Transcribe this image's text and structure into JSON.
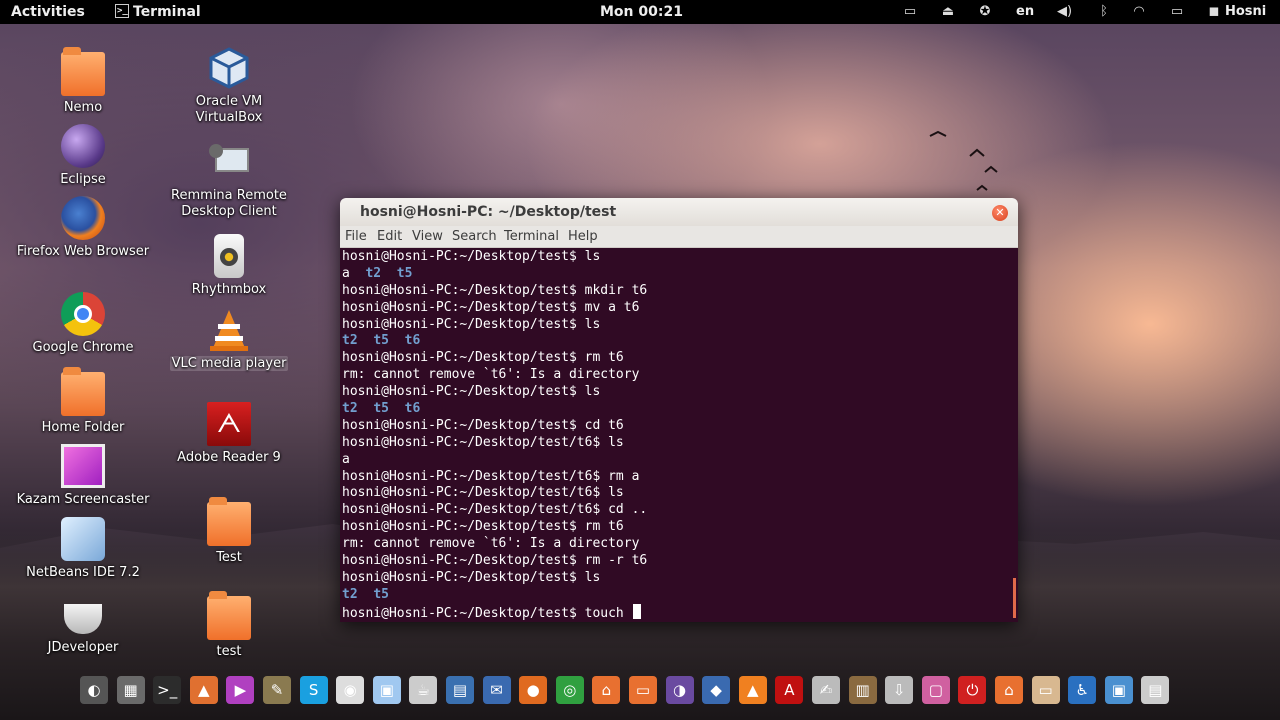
{
  "topbar": {
    "activities": "Activities",
    "app_menu": "Terminal",
    "clock": "Mon 00:21",
    "language": "en",
    "user": "Hosni",
    "tray_icons": [
      "folder-icon",
      "eject-icon",
      "accessibility-icon",
      "volume-icon",
      "bluetooth-icon",
      "wifi-icon",
      "battery-icon",
      "chat-icon"
    ]
  },
  "desktop": {
    "col1": [
      {
        "label": "Nemo",
        "icon": "folder-icon"
      },
      {
        "label": "Eclipse",
        "icon": "eclipse-icon"
      },
      {
        "label": "Firefox Web Browser",
        "icon": "firefox-icon"
      },
      {
        "label": "Google Chrome",
        "icon": "chrome-icon"
      },
      {
        "label": "Home Folder",
        "icon": "folder-icon"
      },
      {
        "label": "Kazam Screencaster",
        "icon": "kazam-icon"
      },
      {
        "label": "NetBeans IDE 7.2",
        "icon": "netbeans-icon"
      },
      {
        "label": "JDeveloper",
        "icon": "jdeveloper-icon"
      }
    ],
    "col2": [
      {
        "label": "Oracle VM VirtualBox",
        "icon": "virtualbox-icon"
      },
      {
        "label": "Remmina Remote Desktop Client",
        "icon": "remmina-icon"
      },
      {
        "label": "Rhythmbox",
        "icon": "rhythmbox-icon"
      },
      {
        "label": "VLC media player",
        "icon": "vlc-icon"
      },
      {
        "label": "Adobe Reader 9",
        "icon": "adobe-reader-icon"
      },
      {
        "label": "Test",
        "icon": "folder-icon"
      },
      {
        "label": "test",
        "icon": "folder-icon"
      }
    ]
  },
  "terminal": {
    "title": "hosni@Hosni-PC: ~/Desktop/test",
    "menu": [
      "File",
      "Edit",
      "View",
      "Search",
      "Terminal",
      "Help"
    ],
    "lines": [
      {
        "type": "cmd",
        "text": "hosni@Hosni-PC:~/Desktop/test$ ls"
      },
      {
        "type": "mixed",
        "parts": [
          {
            "t": "a",
            "dir": false
          },
          {
            "t": "  ",
            "dir": false
          },
          {
            "t": "t2",
            "dir": true
          },
          {
            "t": "  ",
            "dir": false
          },
          {
            "t": "t5",
            "dir": true
          }
        ]
      },
      {
        "type": "cmd",
        "text": "hosni@Hosni-PC:~/Desktop/test$ mkdir t6"
      },
      {
        "type": "cmd",
        "text": "hosni@Hosni-PC:~/Desktop/test$ mv a t6"
      },
      {
        "type": "cmd",
        "text": "hosni@Hosni-PC:~/Desktop/test$ ls"
      },
      {
        "type": "mixed",
        "parts": [
          {
            "t": "t2",
            "dir": true
          },
          {
            "t": "  ",
            "dir": false
          },
          {
            "t": "t5",
            "dir": true
          },
          {
            "t": "  ",
            "dir": false
          },
          {
            "t": "t6",
            "dir": true
          }
        ]
      },
      {
        "type": "cmd",
        "text": "hosni@Hosni-PC:~/Desktop/test$ rm t6"
      },
      {
        "type": "cmd",
        "text": "rm: cannot remove `t6': Is a directory"
      },
      {
        "type": "cmd",
        "text": "hosni@Hosni-PC:~/Desktop/test$ ls"
      },
      {
        "type": "mixed",
        "parts": [
          {
            "t": "t2",
            "dir": true
          },
          {
            "t": "  ",
            "dir": false
          },
          {
            "t": "t5",
            "dir": true
          },
          {
            "t": "  ",
            "dir": false
          },
          {
            "t": "t6",
            "dir": true
          }
        ]
      },
      {
        "type": "cmd",
        "text": "hosni@Hosni-PC:~/Desktop/test$ cd t6"
      },
      {
        "type": "cmd",
        "text": "hosni@Hosni-PC:~/Desktop/test/t6$ ls"
      },
      {
        "type": "cmd",
        "text": "a"
      },
      {
        "type": "cmd",
        "text": "hosni@Hosni-PC:~/Desktop/test/t6$ rm a"
      },
      {
        "type": "cmd",
        "text": "hosni@Hosni-PC:~/Desktop/test/t6$ ls"
      },
      {
        "type": "cmd",
        "text": "hosni@Hosni-PC:~/Desktop/test/t6$ cd .."
      },
      {
        "type": "cmd",
        "text": "hosni@Hosni-PC:~/Desktop/test$ rm t6"
      },
      {
        "type": "cmd",
        "text": "rm: cannot remove `t6': Is a directory"
      },
      {
        "type": "cmd",
        "text": "hosni@Hosni-PC:~/Desktop/test$ rm -r t6"
      },
      {
        "type": "cmd",
        "text": "hosni@Hosni-PC:~/Desktop/test$ ls"
      },
      {
        "type": "mixed",
        "parts": [
          {
            "t": "t2",
            "dir": true
          },
          {
            "t": "  ",
            "dir": false
          },
          {
            "t": "t5",
            "dir": true
          }
        ]
      },
      {
        "type": "prompt",
        "text": "hosni@Hosni-PC:~/Desktop/test$ touch "
      }
    ],
    "colors": {
      "background": "#300a24",
      "directory": "#729fcf",
      "text": "#ffffff"
    }
  },
  "dock": [
    {
      "name": "gnome-logo-icon",
      "glyph": "◐",
      "color": "#555"
    },
    {
      "name": "calculator-icon",
      "glyph": "▦",
      "color": "#6a6a6a"
    },
    {
      "name": "terminal-icon",
      "glyph": ">_",
      "color": "#2c2c2c"
    },
    {
      "name": "bag-icon",
      "glyph": "▲",
      "color": "#e07030"
    },
    {
      "name": "kazam-icon",
      "glyph": "▶",
      "color": "#b040c0"
    },
    {
      "name": "gimp-icon",
      "glyph": "✎",
      "color": "#8a7a50"
    },
    {
      "name": "skype-icon",
      "glyph": "S",
      "color": "#1aa0e0"
    },
    {
      "name": "rhythmbox-icon",
      "glyph": "◉",
      "color": "#ddd"
    },
    {
      "name": "netbeans-icon",
      "glyph": "▣",
      "color": "#a0c8f0"
    },
    {
      "name": "jdeveloper-icon",
      "glyph": "☕",
      "color": "#ccc"
    },
    {
      "name": "document-viewer-icon",
      "glyph": "▤",
      "color": "#3a70b0"
    },
    {
      "name": "thunderbird-icon",
      "glyph": "✉",
      "color": "#3a6ab0"
    },
    {
      "name": "firefox-icon",
      "glyph": "●",
      "color": "#e06a20"
    },
    {
      "name": "chrome-icon",
      "glyph": "◎",
      "color": "#30a040"
    },
    {
      "name": "home-folder-icon",
      "glyph": "⌂",
      "color": "#e87030"
    },
    {
      "name": "nemo-icon",
      "glyph": "▭",
      "color": "#e87030"
    },
    {
      "name": "eclipse-icon",
      "glyph": "◑",
      "color": "#6a4aa0"
    },
    {
      "name": "virtualbox-icon",
      "glyph": "◆",
      "color": "#3a6ab0"
    },
    {
      "name": "vlc-icon",
      "glyph": "▲",
      "color": "#f08020"
    },
    {
      "name": "adobe-reader-icon",
      "glyph": "A",
      "color": "#c01010"
    },
    {
      "name": "text-editor-icon",
      "glyph": "✍",
      "color": "#bbb"
    },
    {
      "name": "books-icon",
      "glyph": "▥",
      "color": "#8a6a40"
    },
    {
      "name": "usb-creator-icon",
      "glyph": "⇩",
      "color": "#bbb"
    },
    {
      "name": "screenshot-icon",
      "glyph": "▢",
      "color": "#d060a0"
    },
    {
      "name": "power-icon",
      "glyph": "⏻",
      "color": "#d02020"
    },
    {
      "name": "home-folder-icon-2",
      "glyph": "⌂",
      "color": "#e87030"
    },
    {
      "name": "folder-icon",
      "glyph": "▭",
      "color": "#d8b890"
    },
    {
      "name": "accessibility-icon",
      "glyph": "♿",
      "color": "#2a70c0"
    },
    {
      "name": "software-center-icon",
      "glyph": "▣",
      "color": "#4a90d0"
    },
    {
      "name": "files-icon",
      "glyph": "▤",
      "color": "#ccc"
    }
  ]
}
